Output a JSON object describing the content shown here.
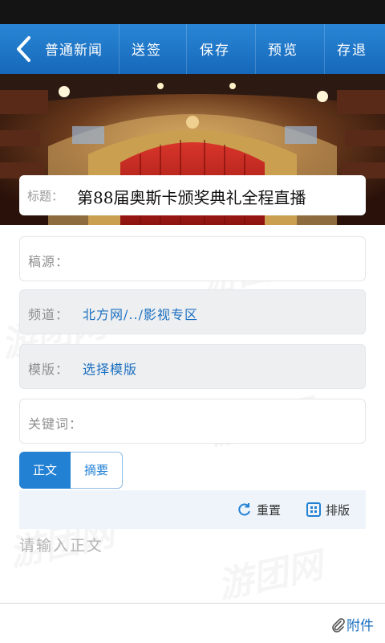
{
  "nav": {
    "title": "普通新闻",
    "send": "送签",
    "save": "保存",
    "preview": "预览",
    "save_exit": "存退"
  },
  "headline": {
    "label": "标题：",
    "value": "第88届奥斯卡颁奖典礼全程直播"
  },
  "fields": {
    "source_label": "稿源：",
    "channel_label": "频道：",
    "channel_value": "北方网/../影视专区",
    "template_label": "模版：",
    "template_value": "选择模版",
    "keywords_label": "关键词："
  },
  "tabs": {
    "body": "正文",
    "summary": "摘要"
  },
  "toolbar": {
    "reset": "重置",
    "layout": "排版"
  },
  "editor": {
    "placeholder": "请输入正文"
  },
  "footer": {
    "attachment": "附件"
  },
  "colors": {
    "accent": "#2381d4",
    "nav_bg": "#1a70c2"
  }
}
